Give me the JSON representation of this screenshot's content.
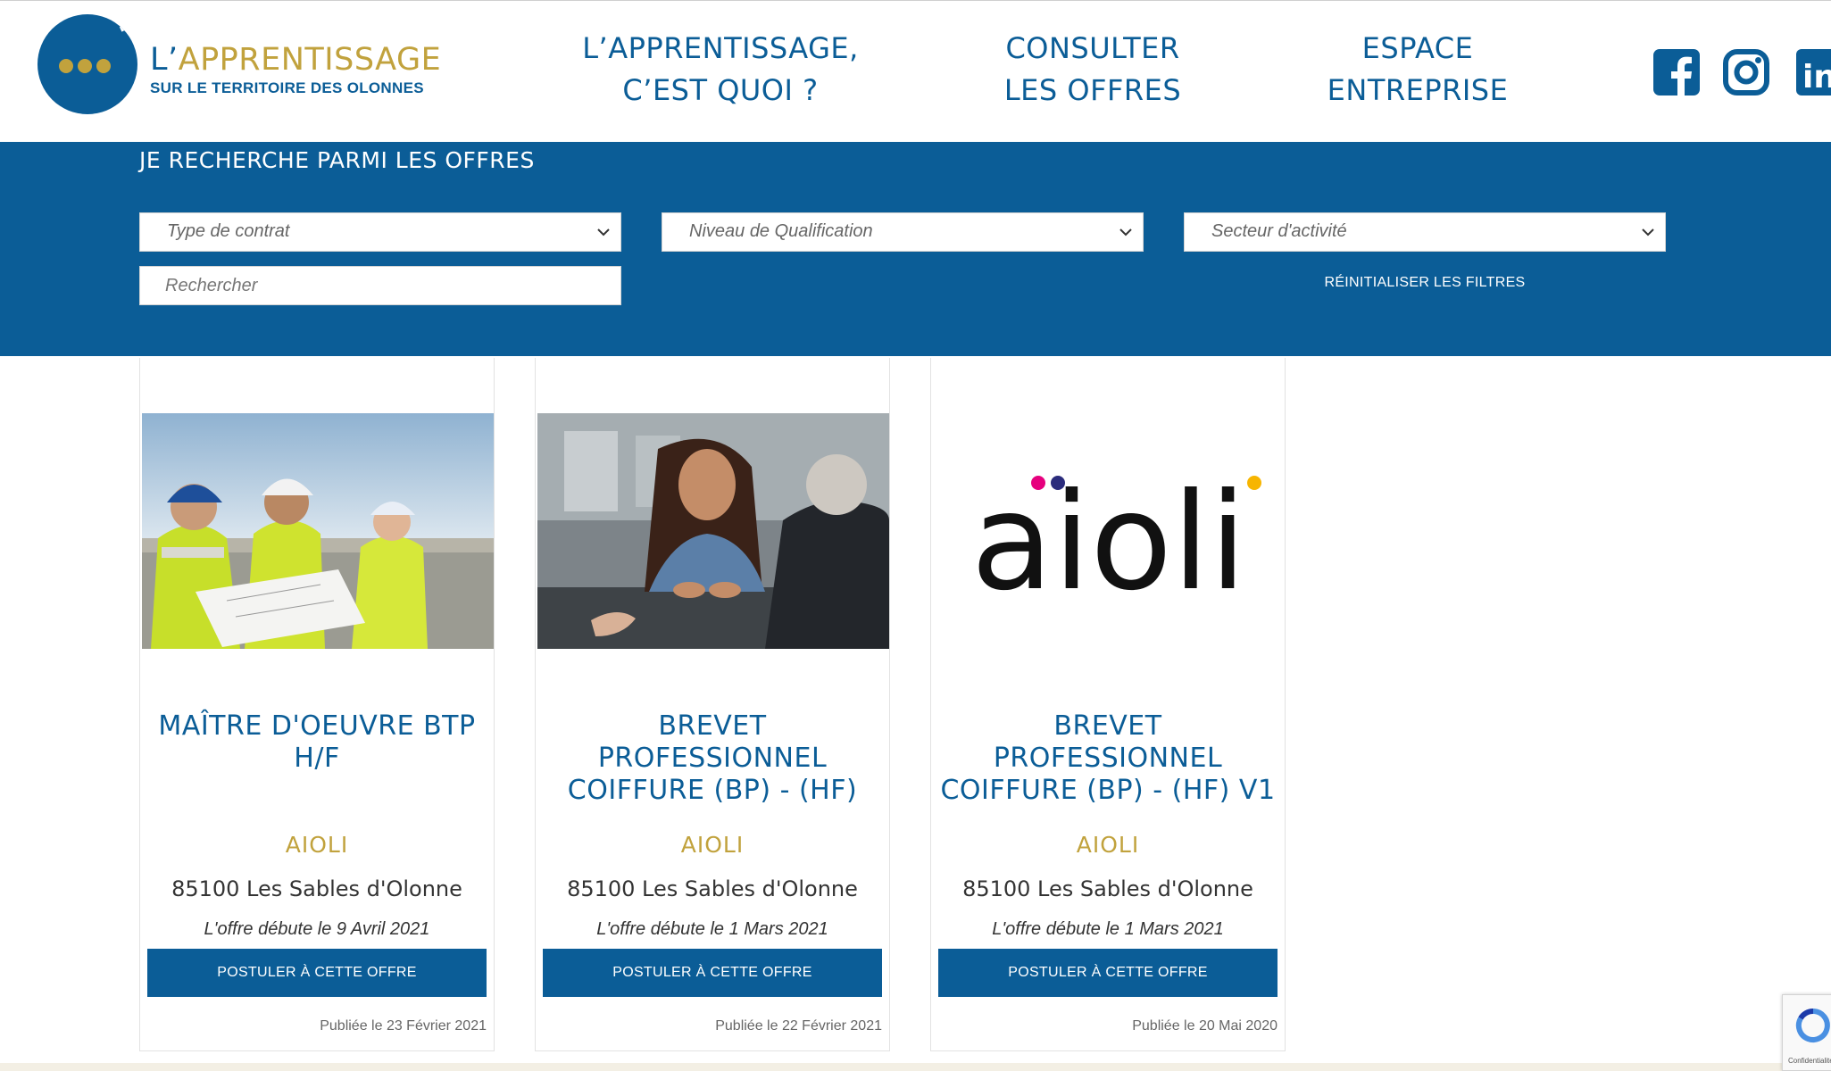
{
  "brand": {
    "title_prefix": "L’",
    "title_main": "APPRENTISSAGE",
    "subtitle": "SUR LE TERRITOIRE DES OLONNES"
  },
  "nav": [
    {
      "line1": "L’APPRENTISSAGE,",
      "line2": "C’EST QUOI ?"
    },
    {
      "line1": "CONSULTER",
      "line2": "LES OFFRES"
    },
    {
      "line1": "ESPACE",
      "line2": "ENTREPRISE"
    }
  ],
  "social": {
    "facebook_icon": "facebook-icon",
    "instagram_icon": "instagram-icon",
    "linkedin_icon": "linkedin-icon",
    "linkedin_text": "in"
  },
  "filters": {
    "heading": "JE RECHERCHE PARMI LES OFFRES",
    "contract_type": "Type de contrat",
    "qualification": "Niveau de Qualification",
    "sector": "Secteur d'activité",
    "search_placeholder": "Rechercher",
    "reset_label": "RÉINITIALISER LES FILTRES"
  },
  "offers": [
    {
      "title": "MAÎTRE D'OEUVRE BTP H/F",
      "company": "AIOLI",
      "location": "85100 Les Sables d'Olonne",
      "start": "L'offre débute le 9 Avril 2021",
      "apply": "POSTULER À CETTE OFFRE",
      "published": "Publiée le 23 Février 2021"
    },
    {
      "title": "BREVET PROFESSIONNEL COIFFURE (BP) - (HF)",
      "company": "AIOLI",
      "location": "85100 Les Sables d'Olonne",
      "start": "L'offre débute le 1 Mars 2021",
      "apply": "POSTULER À CETTE OFFRE",
      "published": "Publiée le 22 Février 2021"
    },
    {
      "title": "BREVET PROFESSIONNEL COIFFURE (BP) - (HF) V1",
      "company": "AIOLI",
      "location": "85100 Les Sables d'Olonne",
      "start": "L'offre débute le 1 Mars 2021",
      "apply": "POSTULER À CETTE OFFRE",
      "published": "Publiée le 20 Mai 2020"
    }
  ],
  "aioli_logo_text": "aioli",
  "recaptcha_label": "Confidentialité",
  "colors": {
    "primary": "#0b5d97",
    "gold": "#c1a23d",
    "white": "#ffffff",
    "footer": "#f3efe4",
    "aioli_pink": "#e6007e",
    "aioli_navy": "#2b2c7c",
    "aioli_yellow": "#f7b500"
  }
}
